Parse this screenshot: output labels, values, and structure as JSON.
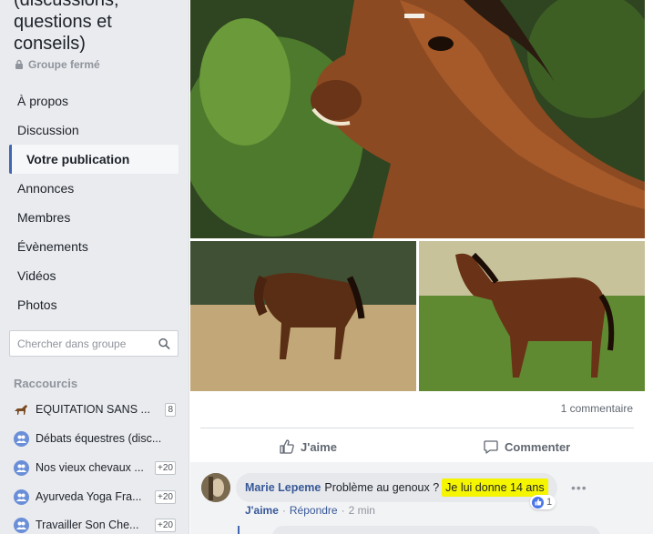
{
  "group": {
    "title": "(discussions, questions et conseils)",
    "status": "Groupe fermé"
  },
  "nav": {
    "items": [
      {
        "label": "À propos",
        "active": false
      },
      {
        "label": "Discussion",
        "active": false
      },
      {
        "label": "Votre publication",
        "active": true
      },
      {
        "label": "Annonces",
        "active": false
      },
      {
        "label": "Membres",
        "active": false
      },
      {
        "label": "Évènements",
        "active": false
      },
      {
        "label": "Vidéos",
        "active": false
      },
      {
        "label": "Photos",
        "active": false
      }
    ]
  },
  "search": {
    "placeholder": "Chercher dans groupe"
  },
  "shortcuts": {
    "title": "Raccourcis",
    "items": [
      {
        "label": "EQUITATION SANS ...",
        "badge": "8",
        "icon": "horse-icon"
      },
      {
        "label": "Débats équestres (disc...",
        "badge": "",
        "icon": "group-icon"
      },
      {
        "label": "Nos vieux chevaux ...",
        "badge": "+20",
        "icon": "group-icon"
      },
      {
        "label": "Ayurveda Yoga Fra...",
        "badge": "+20",
        "icon": "group-icon"
      },
      {
        "label": "Travailler Son Che...",
        "badge": "+20",
        "icon": "group-icon"
      }
    ]
  },
  "post": {
    "comment_count": "1 commentaire",
    "like_label": "J'aime",
    "comment_label": "Commenter"
  },
  "comment": {
    "author": "Marie Lepeme",
    "text": "Problème au genoux ?",
    "highlighted_text": "Je lui donne 14 ans",
    "reaction_count": "1",
    "like_action": "J'aime",
    "reply_action": "Répondre",
    "separator": "·",
    "time": "2 min",
    "highlight_color": "#f5f500"
  },
  "colors": {
    "accent": "#4267b2",
    "link": "#385898"
  }
}
